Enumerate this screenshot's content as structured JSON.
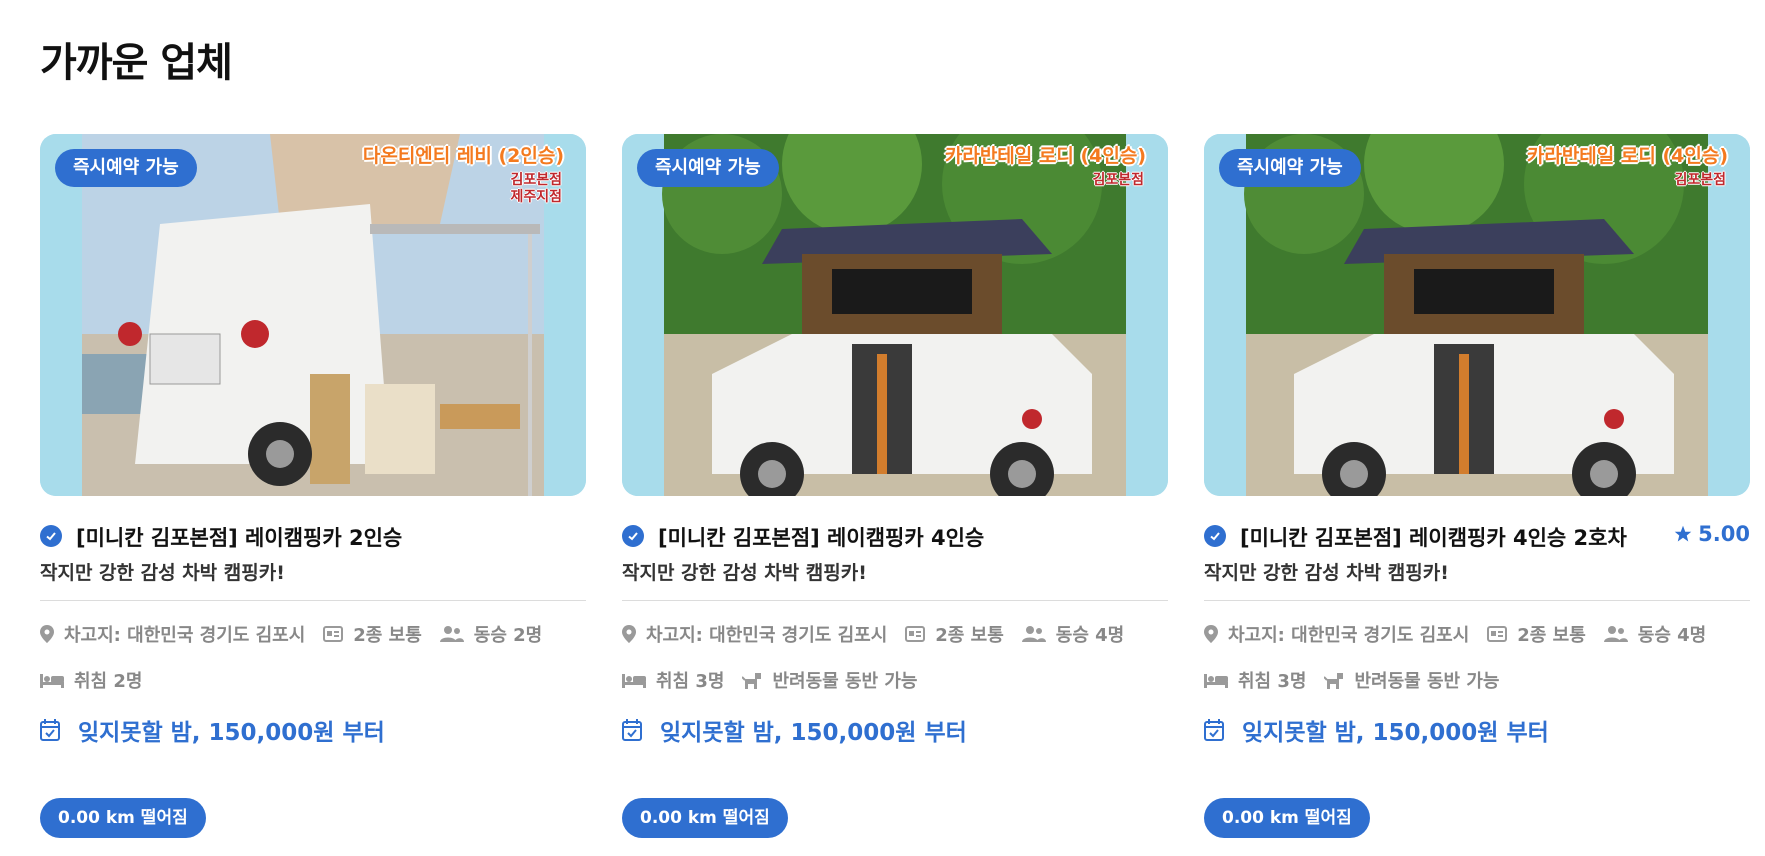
{
  "section_title": "가까운 업체",
  "cards": [
    {
      "badge": "즉시예약 가능",
      "overlay_title": "다온티엔티 레비 (2인승)",
      "overlay_sub": "김포본점\n제주지점",
      "title": "[미니칸 김포본점] 레이캠핑카 2인승",
      "rating": "",
      "subtitle": "작지만 강한 감성 차박 캠핑카!",
      "location": "차고지: 대한민국 경기도 김포시",
      "license": "2종 보통",
      "passengers": "동승 2명",
      "sleeping": "취침 2명",
      "pets": "",
      "price": "잊지못할 밤, 150,000원 부터",
      "distance": "0.00 km 떨어짐"
    },
    {
      "badge": "즉시예약 가능",
      "overlay_title": "카라반테일 로디 (4인승)",
      "overlay_sub": "김포본점",
      "title": "[미니칸 김포본점] 레이캠핑카 4인승",
      "rating": "",
      "subtitle": "작지만 강한 감성 차박 캠핑카!",
      "location": "차고지: 대한민국 경기도 김포시",
      "license": "2종 보통",
      "passengers": "동승 4명",
      "sleeping": "취침 3명",
      "pets": "반려동물 동반 가능",
      "price": "잊지못할 밤, 150,000원 부터",
      "distance": "0.00 km 떨어짐"
    },
    {
      "badge": "즉시예약 가능",
      "overlay_title": "카라반테일 로디 (4인승)",
      "overlay_sub": "김포본점",
      "title": "[미니칸 김포본점] 레이캠핑카 4인승 2호차",
      "rating": "5.00",
      "subtitle": "작지만 강한 감성 차박 캠핑카!",
      "location": "차고지: 대한민국 경기도 김포시",
      "license": "2종 보통",
      "passengers": "동승 4명",
      "sleeping": "취침 3명",
      "pets": "반려동물 동반 가능",
      "price": "잊지못할 밤, 150,000원 부터",
      "distance": "0.00 km 떨어짐"
    }
  ],
  "colors": {
    "accent": "#2f6fd0",
    "muted": "#888888",
    "overlay_orange": "#f47a1f"
  },
  "icons": {
    "verified": "check-circle-icon",
    "rating": "star-icon",
    "location": "map-pin-icon",
    "license": "id-card-icon",
    "passengers": "users-icon",
    "sleeping": "bed-icon",
    "pets": "dog-icon",
    "price": "calendar-check-icon"
  }
}
